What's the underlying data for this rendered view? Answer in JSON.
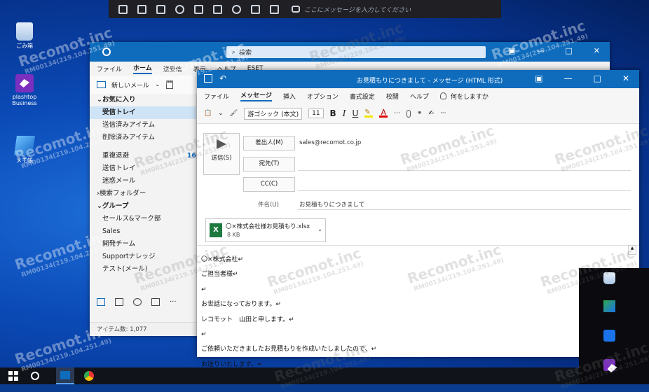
{
  "remote_toolbar": {
    "message_placeholder": "ここにメッセージを入力してください"
  },
  "desktop": {
    "icons": [
      {
        "label": "ごみ箱"
      },
      {
        "label": "plashtop Business"
      },
      {
        "label": "メモ帳"
      }
    ]
  },
  "outlook": {
    "search_placeholder": "検索",
    "ribbon_tabs": [
      "ファイル",
      "ホーム",
      "送受信",
      "表示",
      "ヘルプ",
      "ESET"
    ],
    "new_mail_label": "新しいメール",
    "folders": {
      "favorites_header": "お気に入り",
      "items": [
        {
          "label": "受信トレイ",
          "selected": true
        },
        {
          "label": "送信済みアイテム"
        },
        {
          "label": "削除済みアイテム"
        },
        {
          "label": "重複退避",
          "count": "16"
        },
        {
          "label": "送信トレイ"
        },
        {
          "label": "迷惑メール"
        }
      ],
      "search_folders": "検索フォルダー",
      "group_header": "グループ",
      "groups": [
        "セールス&マーク部",
        "Sales",
        "開発チーム",
        "Supportナレッジ",
        "テスト(メール)"
      ]
    },
    "status": "アイテム数: 1,077"
  },
  "message": {
    "title": "お見積もりにつきまして - メッセージ (HTML 形式)",
    "tabs": [
      "ファイル",
      "メッセージ",
      "挿入",
      "オプション",
      "書式設定",
      "校閲",
      "ヘルプ"
    ],
    "tell_me": "何をしますか",
    "font_name": "游ゴシック (本文)",
    "font_size": "11",
    "send_label": "送信(S)",
    "from_label": "差出人(M)",
    "from_value": "sales@recomot.co.jp",
    "to_label": "宛先(T)",
    "cc_label": "CC(C)",
    "subject_label": "件名(U)",
    "subject_value": "お見積もりにつきまして",
    "attachment": {
      "name": "〇×株式会社様お見積もり.xlsx",
      "size": "8 KB"
    },
    "body_lines": [
      "〇×株式会社↵",
      "ご担当者様↵",
      "↵",
      "お世話になっております。↵",
      "レコモット　山田と申します。↵",
      "↵",
      "ご依頼いただきましたお見積もりを作成いたしましたので、↵",
      "お送りいたします。↵"
    ]
  },
  "watermark": {
    "brand": "Recomot.inc",
    "id": "RM00134(219.104.251.49)"
  },
  "colors": {
    "outlook_blue": "#0f6cbd",
    "excel_green": "#1d7a3f"
  }
}
